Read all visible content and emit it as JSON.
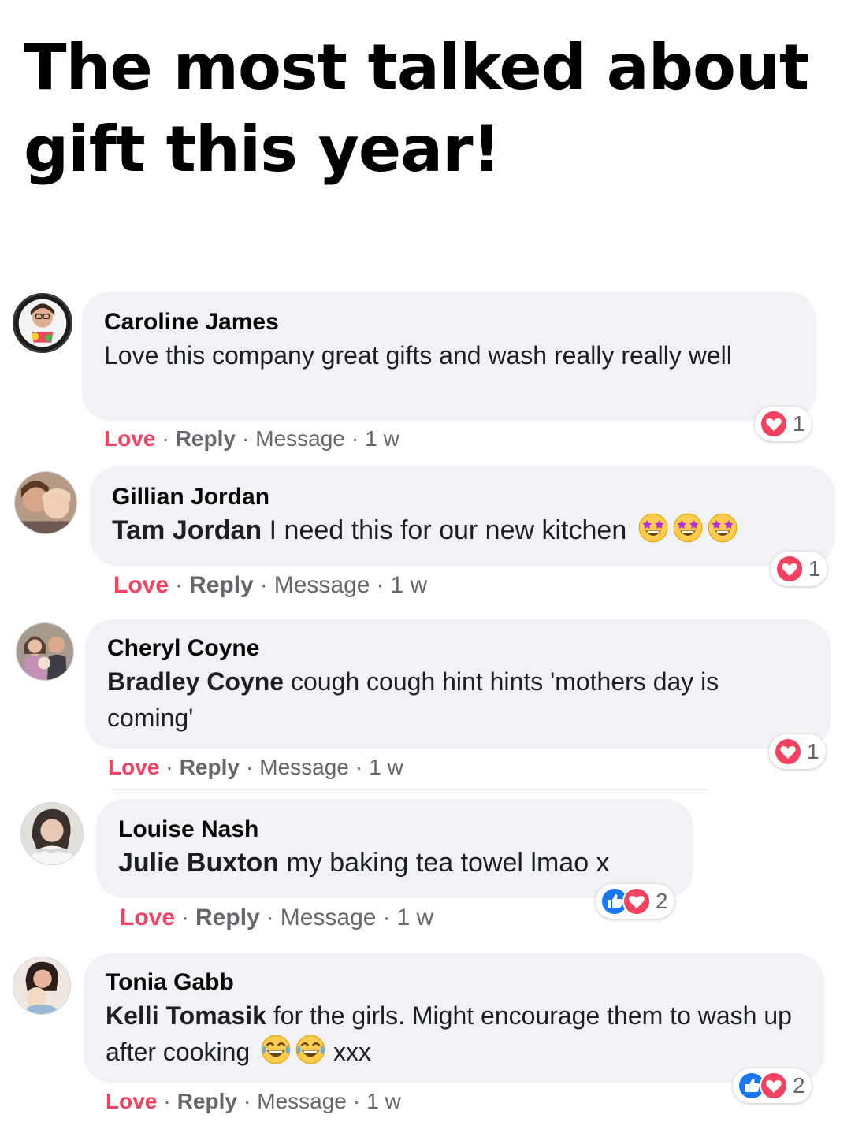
{
  "headline": "The most talked about gift this year!",
  "colors": {
    "love": "#f3425f",
    "like": "#1877f2",
    "bubble": "#f0f2f5",
    "meta": "#65676b"
  },
  "comments": [
    {
      "author": "Caroline James",
      "tag": "",
      "text": "Love this company great gifts and wash really really well",
      "emojis": [],
      "reactions": {
        "icons": [
          "heart-icon"
        ],
        "count": "1"
      },
      "actions": {
        "love": "Love",
        "reply": "Reply",
        "message": "Message",
        "time": "1 w"
      }
    },
    {
      "author": "Gillian Jordan",
      "tag": "Tam Jordan",
      "text": "I need this for our new kitchen",
      "emojis": [
        "star-struck-emoji",
        "star-struck-emoji",
        "star-struck-emoji"
      ],
      "reactions": {
        "icons": [
          "heart-icon"
        ],
        "count": "1"
      },
      "actions": {
        "love": "Love",
        "reply": "Reply",
        "message": "Message",
        "time": "1 w"
      }
    },
    {
      "author": "Cheryl Coyne",
      "tag": "Bradley Coyne",
      "text": "cough cough hint hints 'mothers day is coming'",
      "emojis": [],
      "reactions": {
        "icons": [
          "heart-icon"
        ],
        "count": "1"
      },
      "actions": {
        "love": "Love",
        "reply": "Reply",
        "message": "Message",
        "time": "1 w"
      }
    },
    {
      "author": "Louise Nash",
      "tag": "Julie Buxton",
      "text": "my baking tea towel lmao x",
      "emojis": [],
      "reactions": {
        "icons": [
          "like-icon",
          "heart-icon"
        ],
        "count": "2"
      },
      "actions": {
        "love": "Love",
        "reply": "Reply",
        "message": "Message",
        "time": "1 w"
      }
    },
    {
      "author": "Tonia Gabb",
      "tag": "Kelli Tomasik",
      "text": "for the girls. Might encourage them to wash up after cooking",
      "text_tail": "xxx",
      "emojis": [
        "tears-of-joy-emoji",
        "tears-of-joy-emoji"
      ],
      "reactions": {
        "icons": [
          "like-icon",
          "heart-icon"
        ],
        "count": "2"
      },
      "actions": {
        "love": "Love",
        "reply": "Reply",
        "message": "Message",
        "time": "1 w"
      }
    }
  ]
}
